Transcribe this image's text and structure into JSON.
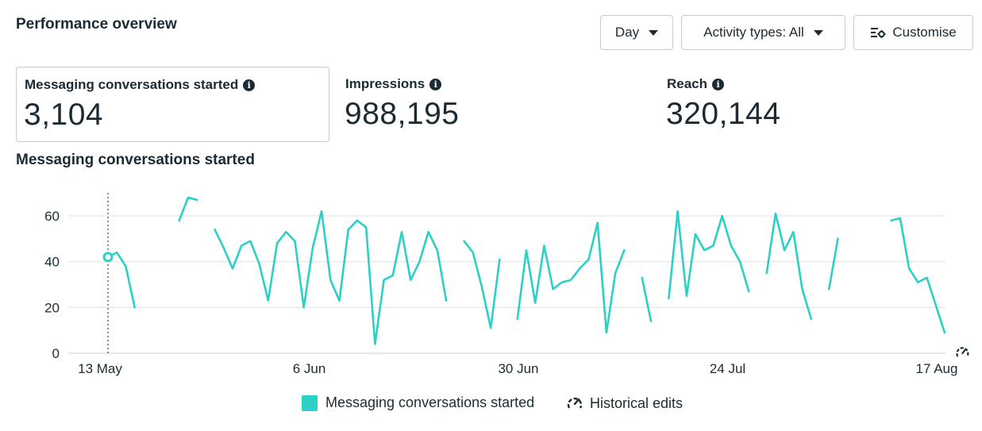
{
  "header": {
    "title": "Performance overview",
    "day_button": "Day",
    "activity_button": "Activity types: All",
    "customise_button": "Customise"
  },
  "metrics": [
    {
      "label": "Messaging conversations started",
      "value": "3,104",
      "selected": true
    },
    {
      "label": "Impressions",
      "value": "988,195",
      "selected": false
    },
    {
      "label": "Reach",
      "value": "320,144",
      "selected": false
    }
  ],
  "icons": {
    "info": "info-icon",
    "dropdown": "caret-down-icon",
    "customise": "customise-icon",
    "historical_edits": "historical-edits-icon"
  },
  "colors": {
    "series": "#2bd0c6",
    "text": "#1c2b33",
    "grid": "#dddfe2",
    "border": "#c6cbd0"
  },
  "chart_data": {
    "type": "line",
    "title": "Messaging conversations started",
    "xlabel": "",
    "ylabel": "",
    "ylim": [
      0,
      70
    ],
    "yticks": [
      0,
      20,
      40,
      60
    ],
    "x_start": "13 May",
    "x_tick_labels": [
      "13 May",
      "6 Jun",
      "30 Jun",
      "24 Jul",
      "17 Aug"
    ],
    "grid": true,
    "legend_position": "bottom",
    "legend": [
      "Messaging conversations started",
      "Historical edits"
    ],
    "highlight_day": 0,
    "historical_edit_day": 96,
    "series": [
      {
        "name": "Messaging conversations started",
        "values": [
          42,
          44,
          38,
          20,
          null,
          null,
          null,
          null,
          58,
          68,
          67,
          null,
          54,
          46,
          37,
          47,
          49,
          39,
          23,
          48,
          53,
          49,
          20,
          46,
          62,
          32,
          23,
          54,
          58,
          55,
          4,
          32,
          34,
          53,
          32,
          40,
          53,
          45,
          23,
          null,
          49,
          44,
          29,
          11,
          41,
          null,
          15,
          45,
          22,
          47,
          28,
          31,
          32,
          37,
          41,
          57,
          9,
          35,
          45,
          null,
          33,
          14,
          null,
          24,
          62,
          25,
          52,
          45,
          47,
          60,
          47,
          40,
          27,
          null,
          35,
          61,
          45,
          53,
          28,
          15,
          null,
          28,
          50,
          null,
          null,
          null,
          null,
          null,
          58,
          59,
          37,
          31,
          33,
          21,
          9
        ]
      }
    ]
  },
  "legend": {
    "series_label": "Messaging conversations started",
    "edits_label": "Historical edits"
  }
}
